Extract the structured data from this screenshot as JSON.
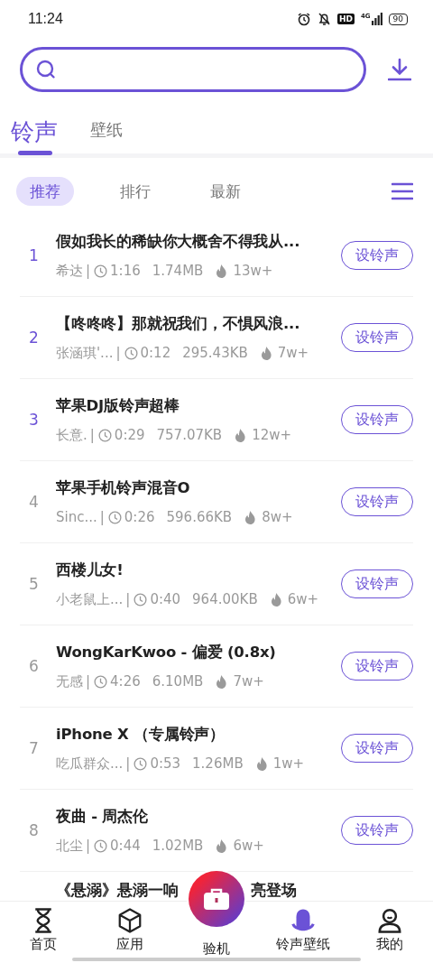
{
  "status_bar": {
    "time": "11:24",
    "hd": "HD",
    "network": "4G",
    "battery": "90"
  },
  "tabs": [
    {
      "label": "铃声",
      "selected": true
    },
    {
      "label": "壁纸",
      "selected": false
    }
  ],
  "sub_tabs": [
    {
      "label": "推荐",
      "selected": true
    },
    {
      "label": "排行",
      "selected": false
    },
    {
      "label": "最新",
      "selected": false
    }
  ],
  "rows": [
    {
      "number": "1",
      "top": true,
      "title": "假如我长的稀缺你大概舍不得我从...",
      "author": "希达",
      "sep": "|",
      "duration": "1:16",
      "size": "1.74MB",
      "plays": "13w+",
      "button": "设铃声"
    },
    {
      "number": "2",
      "top": true,
      "title": "【咚咚咚】那就祝我们，不惧风浪...",
      "author": "张涵琪'...",
      "sep": "|",
      "duration": "0:12",
      "size": "295.43KB",
      "plays": "7w+",
      "button": "设铃声"
    },
    {
      "number": "3",
      "top": true,
      "title": "苹果DJ版铃声超棒",
      "author": "长意.",
      "sep": "|",
      "duration": "0:29",
      "size": "757.07KB",
      "plays": "12w+",
      "button": "设铃声"
    },
    {
      "number": "4",
      "top": false,
      "title": "苹果手机铃声混音O",
      "author": "Sinc...",
      "sep": "|",
      "duration": "0:26",
      "size": "596.66KB",
      "plays": "8w+",
      "button": "设铃声"
    },
    {
      "number": "5",
      "top": false,
      "title": "西楼儿女!",
      "author": "小老鼠上...",
      "sep": "|",
      "duration": "0:40",
      "size": "964.00KB",
      "plays": "6w+",
      "button": "设铃声"
    },
    {
      "number": "6",
      "top": false,
      "title": "WongKarKwoo - 偏爱 (0.8x)",
      "author": "无感",
      "sep": "|",
      "duration": "4:26",
      "size": "6.10MB",
      "plays": "7w+",
      "button": "设铃声"
    },
    {
      "number": "7",
      "top": false,
      "title": "iPhone X （专属铃声）",
      "author": "吃瓜群众...",
      "sep": "|",
      "duration": "0:53",
      "size": "1.26MB",
      "plays": "1w+",
      "button": "设铃声"
    },
    {
      "number": "8",
      "top": false,
      "title": "夜曲 - 周杰伦",
      "author": "北尘",
      "sep": "|",
      "duration": "0:44",
      "size": "1.02MB",
      "plays": "6w+",
      "button": "设铃声"
    }
  ],
  "partial_row": {
    "title_parts": [
      "《悬溺》悬溺一响",
      "亮登场"
    ]
  },
  "nav": [
    {
      "kind": "home",
      "label": "首页",
      "selected": false
    },
    {
      "kind": "apps",
      "label": "应用",
      "selected": false
    },
    {
      "kind": "center",
      "label": "验机",
      "selected": false
    },
    {
      "kind": "ringtone",
      "label": "铃声壁纸",
      "selected": true
    },
    {
      "kind": "me",
      "label": "我的",
      "selected": false
    }
  ]
}
